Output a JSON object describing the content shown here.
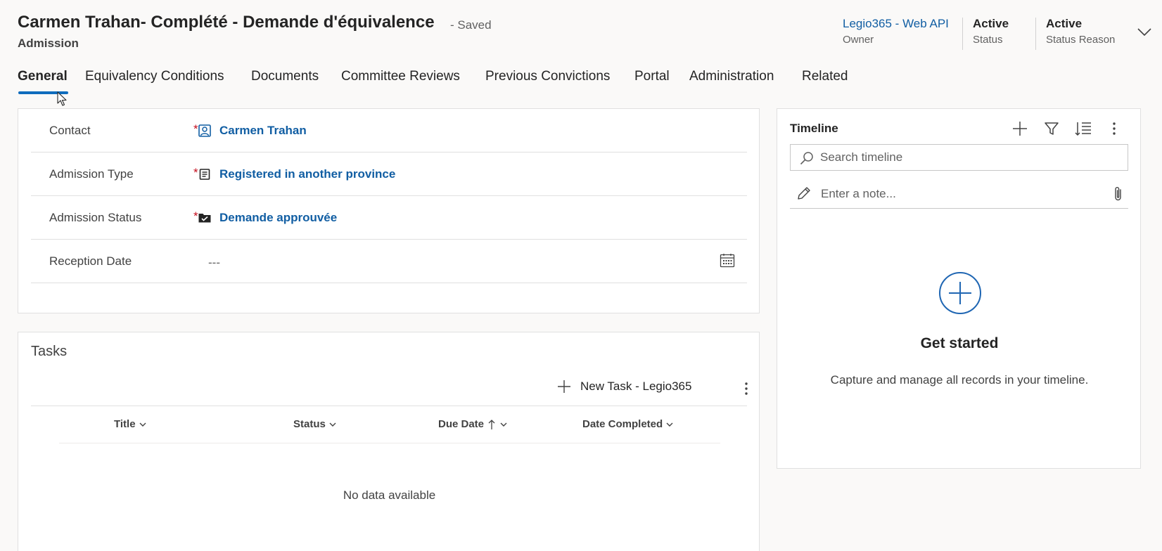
{
  "header": {
    "title": "Carmen Trahan- Complété - Demande d'équivalence",
    "saved_status": "- Saved",
    "entity": "Admission",
    "fields": [
      {
        "value": "Legio365 - Web API",
        "label": "Owner"
      },
      {
        "value": "Active",
        "label": "Status"
      },
      {
        "value": "Active",
        "label": "Status Reason"
      }
    ],
    "expand_icon": "chevron-down-icon"
  },
  "tabs": [
    {
      "label": "General",
      "active": true
    },
    {
      "label": "Equivalency Conditions"
    },
    {
      "label": "Documents"
    },
    {
      "label": "Committee Reviews"
    },
    {
      "label": "Previous Convictions"
    },
    {
      "label": "Portal"
    },
    {
      "label": "Administration"
    },
    {
      "label": "Related"
    }
  ],
  "form": {
    "required_marker": "*",
    "fields": [
      {
        "label": "Contact",
        "value": "Carmen Trahan",
        "icon": "contact-icon"
      },
      {
        "label": "Admission Type",
        "value": "Registered in another province",
        "icon": "document-icon"
      },
      {
        "label": "Admission Status",
        "value": "Demande approuvée",
        "icon": "folder-check-icon"
      },
      {
        "label": "Reception Date",
        "value": "---",
        "icon": "calendar-icon"
      }
    ]
  },
  "tasks": {
    "title": "Tasks",
    "new_button": "New Task - Legio365",
    "columns": [
      "Title",
      "Status",
      "Due Date",
      "Date Completed"
    ],
    "empty_message": "No data available"
  },
  "timeline": {
    "title": "Timeline",
    "search_placeholder": "Search timeline",
    "note_placeholder": "Enter a note...",
    "empty_title": "Get started",
    "empty_description": "Capture and manage all records in your timeline."
  },
  "colors": {
    "link": "#115ea3",
    "accent": "#0f6cbd",
    "required": "#c50f1f",
    "timeline_plus": "#1f66b3"
  }
}
